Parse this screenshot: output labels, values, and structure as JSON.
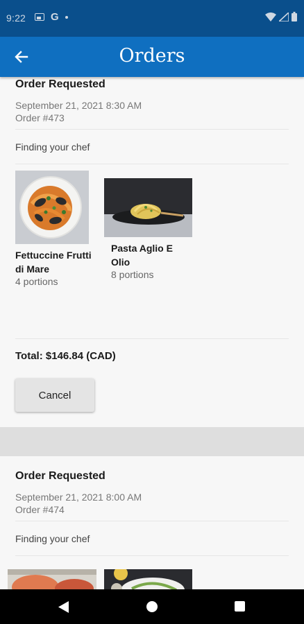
{
  "status_bar": {
    "time": "9:22",
    "left_icons": [
      "image-icon",
      "google-g-icon",
      "dot-icon"
    ],
    "right_icons": [
      "wifi-icon",
      "signal-icon",
      "battery-icon"
    ],
    "g_label": "G"
  },
  "app_bar": {
    "title": "Orders",
    "back_icon": "arrow-left-icon"
  },
  "orders": [
    {
      "status": "Order Requested",
      "date": "September 21, 2021 8:30 AM",
      "number": "Order #473",
      "progress": "Finding your chef",
      "items": [
        {
          "name": "Fettuccine Frutti di Mare",
          "portions": "4 portions"
        },
        {
          "name": "Pasta Aglio E Olio",
          "portions": "8 portions"
        }
      ],
      "total": "Total: $146.84 (CAD)",
      "cancel_label": "Cancel"
    },
    {
      "status": "Order Requested",
      "date": "September 21, 2021 8:00 AM",
      "number": "Order #474",
      "progress": "Finding your chef"
    }
  ],
  "colors": {
    "status_bar": "#0a4f8c",
    "app_bar": "#0f6fc0",
    "background": "#f7f7f7",
    "section_gap": "#dedede"
  },
  "nav_bar": {
    "icons": [
      "nav-back-icon",
      "nav-home-icon",
      "nav-recents-icon"
    ]
  }
}
